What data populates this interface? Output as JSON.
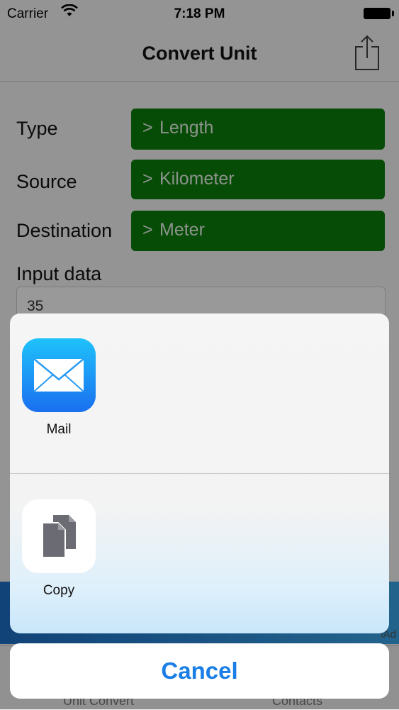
{
  "status": {
    "carrier": "Carrier",
    "time": "7:18 PM"
  },
  "nav": {
    "title": "Convert Unit"
  },
  "form": {
    "type_label": "Type",
    "type_value": "Length",
    "source_label": "Source",
    "source_value": "Kilometer",
    "destination_label": "Destination",
    "destination_value": "Meter",
    "input_label": "Input data",
    "input_value": "35",
    "picker_chevron": ">"
  },
  "ad": {
    "label": "iAd"
  },
  "tabbar": {
    "tabs": [
      {
        "label": "Unit Convert"
      },
      {
        "label": "Contacts"
      }
    ]
  },
  "share_sheet": {
    "items": [
      {
        "label": "Mail",
        "icon": "mail-icon"
      },
      {
        "label": "Copy",
        "icon": "copy-icon"
      }
    ],
    "cancel_label": "Cancel"
  },
  "colors": {
    "picker_green": "#0a7d0a",
    "ios_blue": "#1a7ee6"
  }
}
